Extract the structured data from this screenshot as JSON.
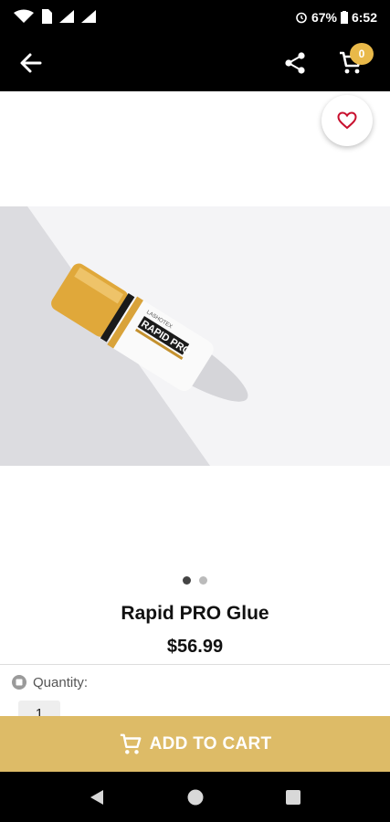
{
  "status_bar": {
    "battery": "67%",
    "time": "6:52",
    "icons": [
      "wifi-icon",
      "signal-icon",
      "alarm-icon",
      "battery-icon"
    ]
  },
  "app_bar": {
    "back_icon": "arrow-left-icon",
    "share_icon": "share-icon",
    "cart_icon": "cart-icon",
    "cart_count": "0"
  },
  "favorite_icon": "heart-outline-icon",
  "product": {
    "image_label": "RAPID PRO",
    "image_brand": "LASHOTEX",
    "title": "Rapid PRO Glue",
    "price": "$56.99",
    "carousel": {
      "count": 2,
      "active_index": 0
    }
  },
  "quantity": {
    "label": "Quantity:",
    "value": "1"
  },
  "add_to_cart_label": "ADD TO CART",
  "colors": {
    "accent": "#ddbb67",
    "badge": "#e9b949",
    "heart": "#c8102e",
    "bars": "#000000"
  },
  "nav": {
    "back_icon": "nav-back-icon",
    "home_icon": "nav-home-icon",
    "recents_icon": "nav-recents-icon"
  }
}
